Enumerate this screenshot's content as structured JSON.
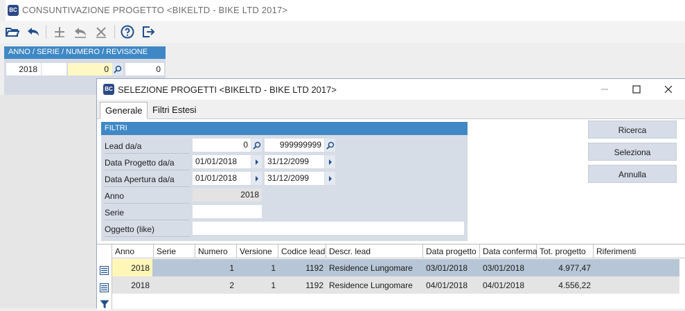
{
  "main": {
    "title": "CONSUNTIVAZIONE PROGETTO <BIKELTD - BIKE LTD 2017>",
    "icon": "app-icon",
    "toolbar": [
      "open-folder-icon",
      "undo-icon",
      "add-icon",
      "revert-icon",
      "delete-icon",
      "help-icon",
      "exit-icon"
    ],
    "header_label": "ANNO / SERIE / NUMERO / REVISIONE",
    "anno": "2018",
    "serie": "",
    "numero": "0",
    "revisione": "0"
  },
  "dialog": {
    "title": "SELEZIONE PROGETTI <BIKELTD - BIKE LTD 2017>",
    "tabs": [
      {
        "label": "Generale",
        "active": true
      },
      {
        "label": "Filtri Estesi",
        "active": false
      }
    ],
    "filters": {
      "header": "FILTRI",
      "lead_label": "Lead da/a",
      "lead_from": "0",
      "lead_to": "999999999",
      "data_progetto_label": "Data Progetto da/a",
      "data_progetto_from": "01/01/2018",
      "data_progetto_to": "31/12/2099",
      "data_apertura_label": "Data Apertura da/a",
      "data_apertura_from": "01/01/2018",
      "data_apertura_to": "31/12/2099",
      "anno_label": "Anno",
      "anno_value": "2018",
      "serie_label": "Serie",
      "serie_value": "",
      "oggetto_label": "Oggetto (like)",
      "oggetto_value": ""
    },
    "buttons": {
      "ricerca": "Ricerca",
      "seleziona": "Seleziona",
      "annulla": "Annulla"
    },
    "grid": {
      "columns": [
        "Anno",
        "Serie",
        "Numero",
        "Versione",
        "Codice lead",
        "Descr. lead",
        "Data progetto",
        "Data conferma",
        "Tot. progetto",
        "Riferimenti"
      ],
      "rows": [
        [
          "2018",
          "",
          "1",
          "1",
          "1192",
          "Residence Lungomare",
          "03/01/2018",
          "03/01/2018",
          "4.977,47",
          ""
        ],
        [
          "2018",
          "",
          "2",
          "1",
          "1192",
          "Residence Lungomare",
          "04/01/2018",
          "04/01/2018",
          "4.556,22",
          ""
        ]
      ]
    }
  },
  "colors": {
    "accent": "#3f88c5",
    "selected_row": "#b7c6d6",
    "highlight_cell": "#fff6b8",
    "filter_bg": "#d7dde7"
  }
}
